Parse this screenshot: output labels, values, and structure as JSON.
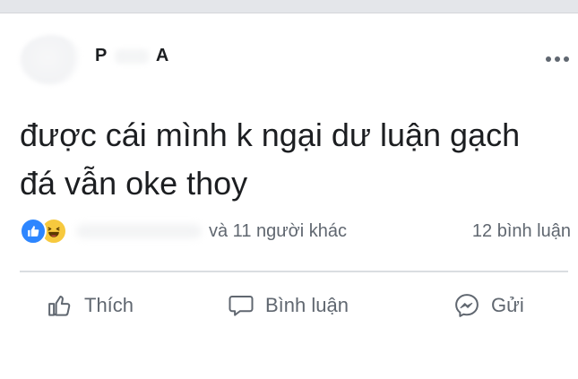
{
  "post": {
    "author_first_initial": "P",
    "author_last_initial": "A",
    "text_line1": "được cái mình k ngại dư luận gạch",
    "text_line2": "đá vẫn oke thoy"
  },
  "reactions": {
    "others_text": "và 11 người khác",
    "comments_text": "12 bình luận"
  },
  "actions": {
    "like_label": "Thích",
    "comment_label": "Bình luận",
    "share_label": "Gửi"
  },
  "colors": {
    "like_blue": "#2d86ff",
    "haha_yellow": "#f7c93e",
    "secondary_text": "#606770",
    "divider": "#dadde1"
  },
  "icons": [
    "more-options-icon",
    "like-reaction-icon",
    "haha-reaction-icon",
    "thumbs-up-icon",
    "comment-bubble-icon",
    "messenger-icon"
  ]
}
